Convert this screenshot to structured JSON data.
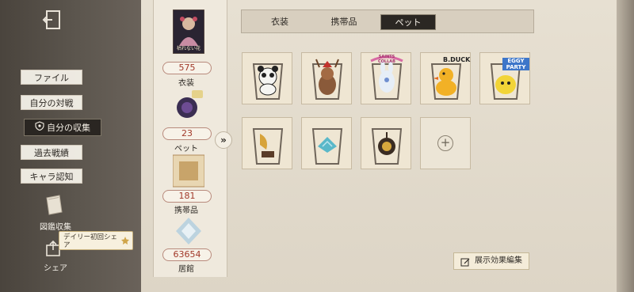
{
  "sidebar": {
    "items": [
      {
        "label": "ファイル"
      },
      {
        "label": "自分の対戦"
      },
      {
        "label": "自分の収集"
      },
      {
        "label": "過去戦績"
      },
      {
        "label": "キャラ認知"
      }
    ],
    "codex_label": "図鑑収集",
    "share_label": "シェア",
    "share_badge": "デイリー初回シェア"
  },
  "summary": {
    "stats": [
      {
        "value": "575",
        "label": "衣装",
        "thumb_text": "枯れない花"
      },
      {
        "value": "23",
        "label": "ペット"
      },
      {
        "value": "181",
        "label": "携帯品"
      },
      {
        "value": "63654",
        "label": "居館"
      }
    ]
  },
  "tabs": [
    {
      "label": "衣装"
    },
    {
      "label": "携帯品"
    },
    {
      "label": "ペット"
    }
  ],
  "grid": {
    "items": [
      {
        "name": "panda"
      },
      {
        "name": "reindeer"
      },
      {
        "name": "rabbit",
        "badge": "SAINTS COLLAB"
      },
      {
        "name": "duck",
        "badge": "B.DUCK"
      },
      {
        "name": "eggy",
        "badge": "EGGY PARTY"
      },
      {
        "name": "gramophone"
      },
      {
        "name": "blue-crystal"
      },
      {
        "name": "lantern"
      }
    ],
    "add_symbol": "+"
  },
  "actions": {
    "effect_label": "展示効果編集"
  },
  "colors": {
    "accent_red": "#a23a2a",
    "dark_tab": "#2b2723"
  }
}
